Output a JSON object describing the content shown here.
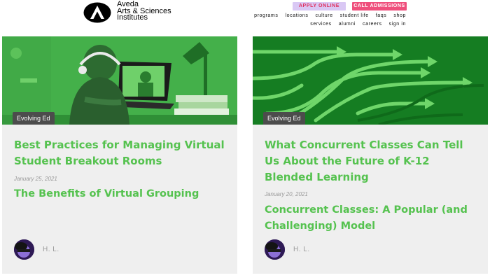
{
  "header": {
    "brand_lines": [
      "Aveda",
      "Arts & Sciences",
      "Institutes"
    ],
    "apply_label": "APPLY ONLINE",
    "admissions_label": "CALL ADMISSIONS",
    "nav_row1": [
      "programs",
      "locations",
      "culture",
      "student life",
      "faqs",
      "shop"
    ],
    "nav_row2": [
      "services",
      "alumni",
      "careers",
      "sign in"
    ]
  },
  "cards": [
    {
      "tag": "Evolving Ed",
      "title": "Best Practices for Managing Virtual Student Breakout Rooms",
      "date": "January 25, 2021",
      "subtitle": "The Benefits of Virtual Grouping",
      "author": "H. L."
    },
    {
      "tag": "Evolving Ed",
      "title": "What Concurrent Classes Can Tell Us About the Future of K-12 Blended Learning",
      "date": "January 20, 2021",
      "subtitle": "Concurrent Classes: A Popular (and Challenging) Model",
      "author": "H. L."
    }
  ],
  "colors": {
    "accent_green": "#55c24f",
    "hero_left": "#44b04a",
    "hero_right": "#157d22",
    "apply_bg": "#d9c8f4",
    "admissions_bg": "#ef4f7c"
  }
}
